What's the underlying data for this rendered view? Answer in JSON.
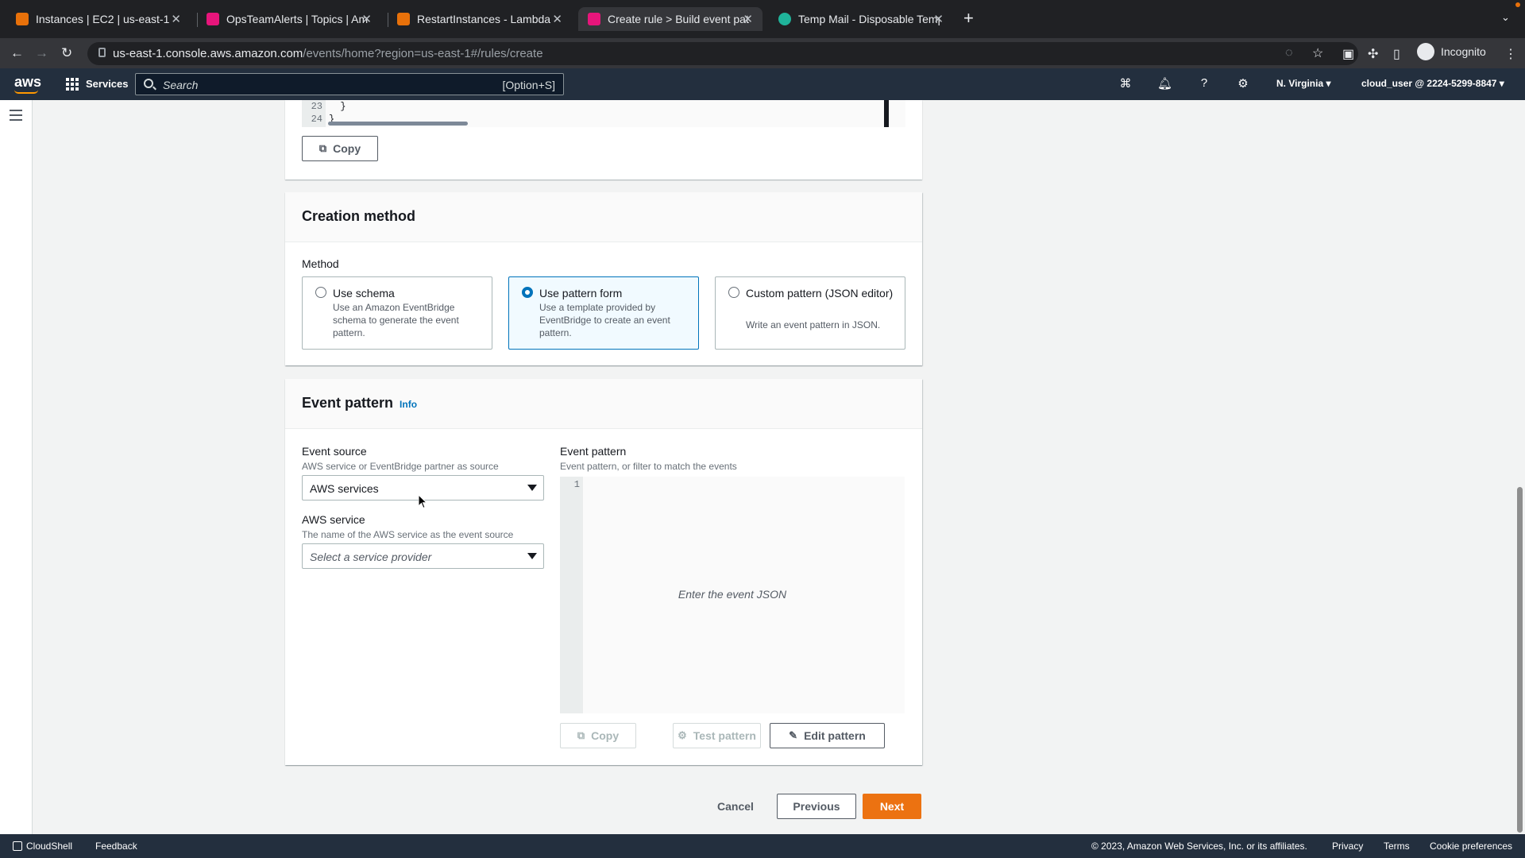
{
  "browser": {
    "tabs": [
      {
        "title": "Instances | EC2 | us-east-1",
        "favicon_color": "#e8710a"
      },
      {
        "title": "OpsTeamAlerts | Topics | Amazon SNS",
        "favicon_color": "#e7157b"
      },
      {
        "title": "RestartInstances - Lambda",
        "favicon_color": "#e8710a"
      },
      {
        "title": "Create rule > Build event pattern",
        "favicon_color": "#e7157b"
      },
      {
        "title": "Temp Mail - Disposable Temporary Email",
        "favicon_color": "#1fb39a"
      }
    ],
    "url_host": "us-east-1.console.aws.amazon.com",
    "url_path": "/events/home?region=us-east-1#/rules/create",
    "profile_label": "Incognito"
  },
  "aws_header": {
    "logo": "aws",
    "services_label": "Services",
    "search_placeholder": "Search",
    "search_shortcut": "[Option+S]",
    "region": "N. Virginia",
    "account": "cloud_user @ 2224-5299-8847"
  },
  "code_preview": {
    "line_numbers": [
      "23",
      "24"
    ],
    "lines": [
      "  }",
      "}"
    ],
    "copy_label": "Copy"
  },
  "creation_method": {
    "title": "Creation method",
    "method_label": "Method",
    "options": [
      {
        "title": "Use schema",
        "description": "Use an Amazon EventBridge schema to generate the event pattern.",
        "selected": false
      },
      {
        "title": "Use pattern form",
        "description": "Use a template provided by EventBridge to create an event pattern.",
        "selected": true
      },
      {
        "title": "Custom pattern (JSON editor)",
        "description": "Write an event pattern in JSON.",
        "selected": false
      }
    ]
  },
  "event_pattern_section": {
    "title": "Event pattern",
    "info_label": "Info",
    "event_source_label": "Event source",
    "event_source_desc": "AWS service or EventBridge partner as source",
    "event_source_value": "AWS services",
    "aws_service_label": "AWS service",
    "aws_service_desc": "The name of the AWS service as the event source",
    "aws_service_placeholder": "Select a service provider",
    "pattern_label": "Event pattern",
    "pattern_desc": "Event pattern, or filter to match the events",
    "editor_line_number": "1",
    "editor_placeholder": "Enter the event JSON",
    "copy_label": "Copy",
    "test_label": "Test pattern",
    "edit_label": "Edit pattern"
  },
  "wizard_actions": {
    "cancel": "Cancel",
    "previous": "Previous",
    "next": "Next"
  },
  "footer": {
    "cloudshell": "CloudShell",
    "feedback": "Feedback",
    "copyright": "© 2023, Amazon Web Services, Inc. or its affiliates.",
    "privacy": "Privacy",
    "terms": "Terms",
    "cookies": "Cookie preferences"
  },
  "colors": {
    "aws_header": "#232f3e",
    "accent_orange": "#ec7211",
    "link_blue": "#0073bb"
  }
}
